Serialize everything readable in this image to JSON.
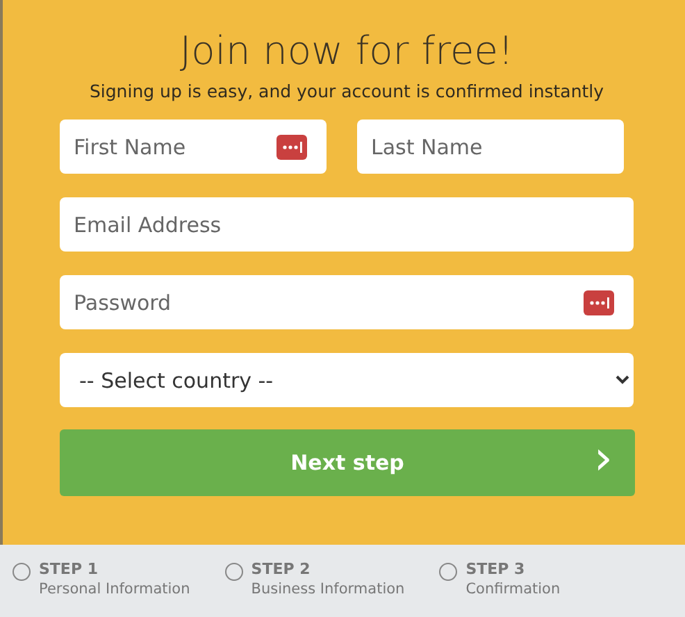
{
  "title": "Join now for free!",
  "subtitle": "Signing up is easy, and your account is confirmed instantly",
  "fields": [
    {
      "placeholder": "First Name",
      "kind": "text",
      "password_manager": true
    },
    {
      "placeholder": "Last Name",
      "kind": "text",
      "password_manager": false
    },
    {
      "placeholder": "Email Address",
      "kind": "text",
      "password_manager": false
    },
    {
      "placeholder": "Password",
      "kind": "password",
      "password_manager": true
    },
    {
      "placeholder": "-- Select country --",
      "kind": "select"
    }
  ],
  "button": {
    "label": "Next step",
    "arrow": "›"
  },
  "steps": [
    {
      "title": "STEP 1",
      "subtitle": "Personal Information",
      "selected": false
    },
    {
      "title": "STEP 2",
      "subtitle": "Business Information",
      "selected": false
    },
    {
      "title": "STEP 3",
      "subtitle": "Confirmation",
      "selected": false
    }
  ]
}
